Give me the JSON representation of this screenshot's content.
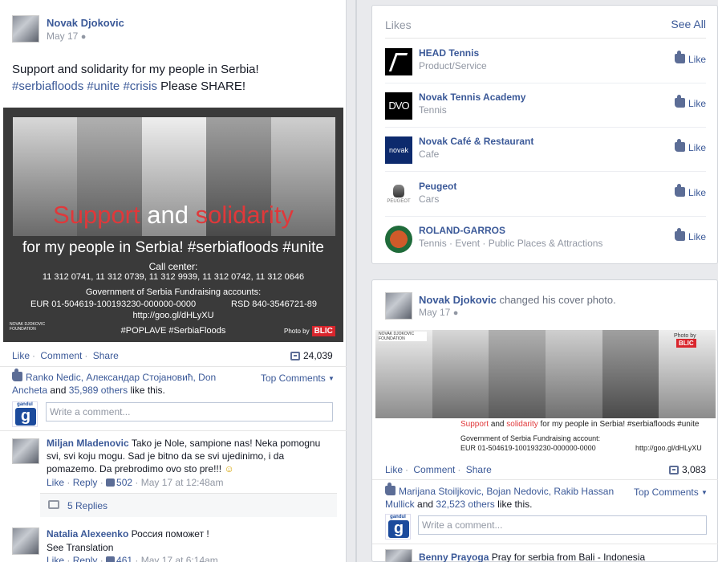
{
  "post1": {
    "author": "Novak Djokovic",
    "date": "May 17",
    "text_line1": "Support and solidarity for my people in Serbia!",
    "hashtags": [
      "#serbiafloods",
      "#unite",
      "#crisis"
    ],
    "text_tail": "Please SHARE!",
    "photo": {
      "word_support": "Support",
      "word_and": "and",
      "word_solidarity": "solidarity",
      "line2": "for my people in Serbia! #serbiafloods #unite",
      "call_center_label": "Call center:",
      "call_center_numbers": "11 312 0741, 11 312 0739, 11 312 9939, 11 312 0742, 11 312 0646",
      "gov_label": "Government of Serbia Fundraising accounts:",
      "eur_account": "EUR 01-504619-100193230-000000-0000",
      "rsd_account": "RSD 840-3546721-89",
      "url": "http://goo.gl/dHLyXU",
      "foundation": "NOVAK DJOKOVIC FOUNDATION",
      "hashtags_bottom": "#POPLAVE #SerbiaFloods",
      "photo_by": "Photo by",
      "photo_source": "BLIC"
    },
    "actions": {
      "like": "Like",
      "comment": "Comment",
      "share": "Share"
    },
    "share_count": "24,039",
    "likers_text": "Ranko Nedic, Александар Стојановић, Don Ancheta",
    "likers_and": "and",
    "likers_others": "35,989 others",
    "likers_tail": "like this.",
    "top_comments": "Top Comments",
    "comment_placeholder": "Write a comment...",
    "commenter_brand": "gandul",
    "comments": [
      {
        "name": "Miljan Mladenovic",
        "text": "Tako je Nole, sampione nas! Neka pomognu svi, svi koju mogu. Sad je bitno da se svi ujedinimo, i da pomazemo. Da prebrodimo ovo sto pre!!!",
        "emoji": "☺",
        "like": "Like",
        "reply": "Reply",
        "likes": "502",
        "time": "May 17 at 12:48am",
        "replies": "5 Replies"
      },
      {
        "name": "Natalia Alexeenko",
        "text": "Россия поможет !",
        "translate": "See Translation",
        "like": "Like",
        "reply": "Reply",
        "likes": "461",
        "time": "May 17 at 6:14am"
      }
    ]
  },
  "likes_box": {
    "title": "Likes",
    "see_all": "See All",
    "like_label": "Like",
    "items": [
      {
        "name": "HEAD Tennis",
        "category": "Product/Service"
      },
      {
        "name": "Novak Tennis Academy",
        "category": "Tennis",
        "logo_text": "DVO"
      },
      {
        "name": "Novak Café & Restaurant",
        "category": "Cafe",
        "logo_text": "novak"
      },
      {
        "name": "Peugeot",
        "category": "Cars",
        "logo_text": "PEUGEOT"
      },
      {
        "name": "ROLAND-GARROS",
        "category": "Tennis · Event · Public Places & Attractions"
      }
    ]
  },
  "post2": {
    "author": "Novak Djokovic",
    "action": "changed his cover photo.",
    "date": "May 17",
    "photo": {
      "foundation": "NOVAK DJOKOVIC FOUNDATION",
      "photo_by": "Photo by",
      "photo_source": "BLIC",
      "word_support": "Support",
      "word_and": "and",
      "word_solidarity": "solidarity",
      "line_tail": "for my people in Serbia! #serbiafloods #unite",
      "gov_label": "Government of Serbia Fundraising account:",
      "eur_account": "EUR 01-504619-100193230-000000-0000",
      "url": "http://goo.gl/dHLyXU"
    },
    "actions": {
      "like": "Like",
      "comment": "Comment",
      "share": "Share"
    },
    "share_count": "3,083",
    "likers_text": "Marijana Stoiljkovic, Bojan Nedovic, Rakib Hassan Mullick",
    "likers_and": "and",
    "likers_others": "32,523 others",
    "likers_tail": "like this.",
    "top_comments": "Top Comments",
    "comment_placeholder": "Write a comment...",
    "commenter_brand": "gandul",
    "comment": {
      "name": "Benny Prayoga",
      "text": "Pray for serbia from Bali - Indonesia"
    }
  }
}
